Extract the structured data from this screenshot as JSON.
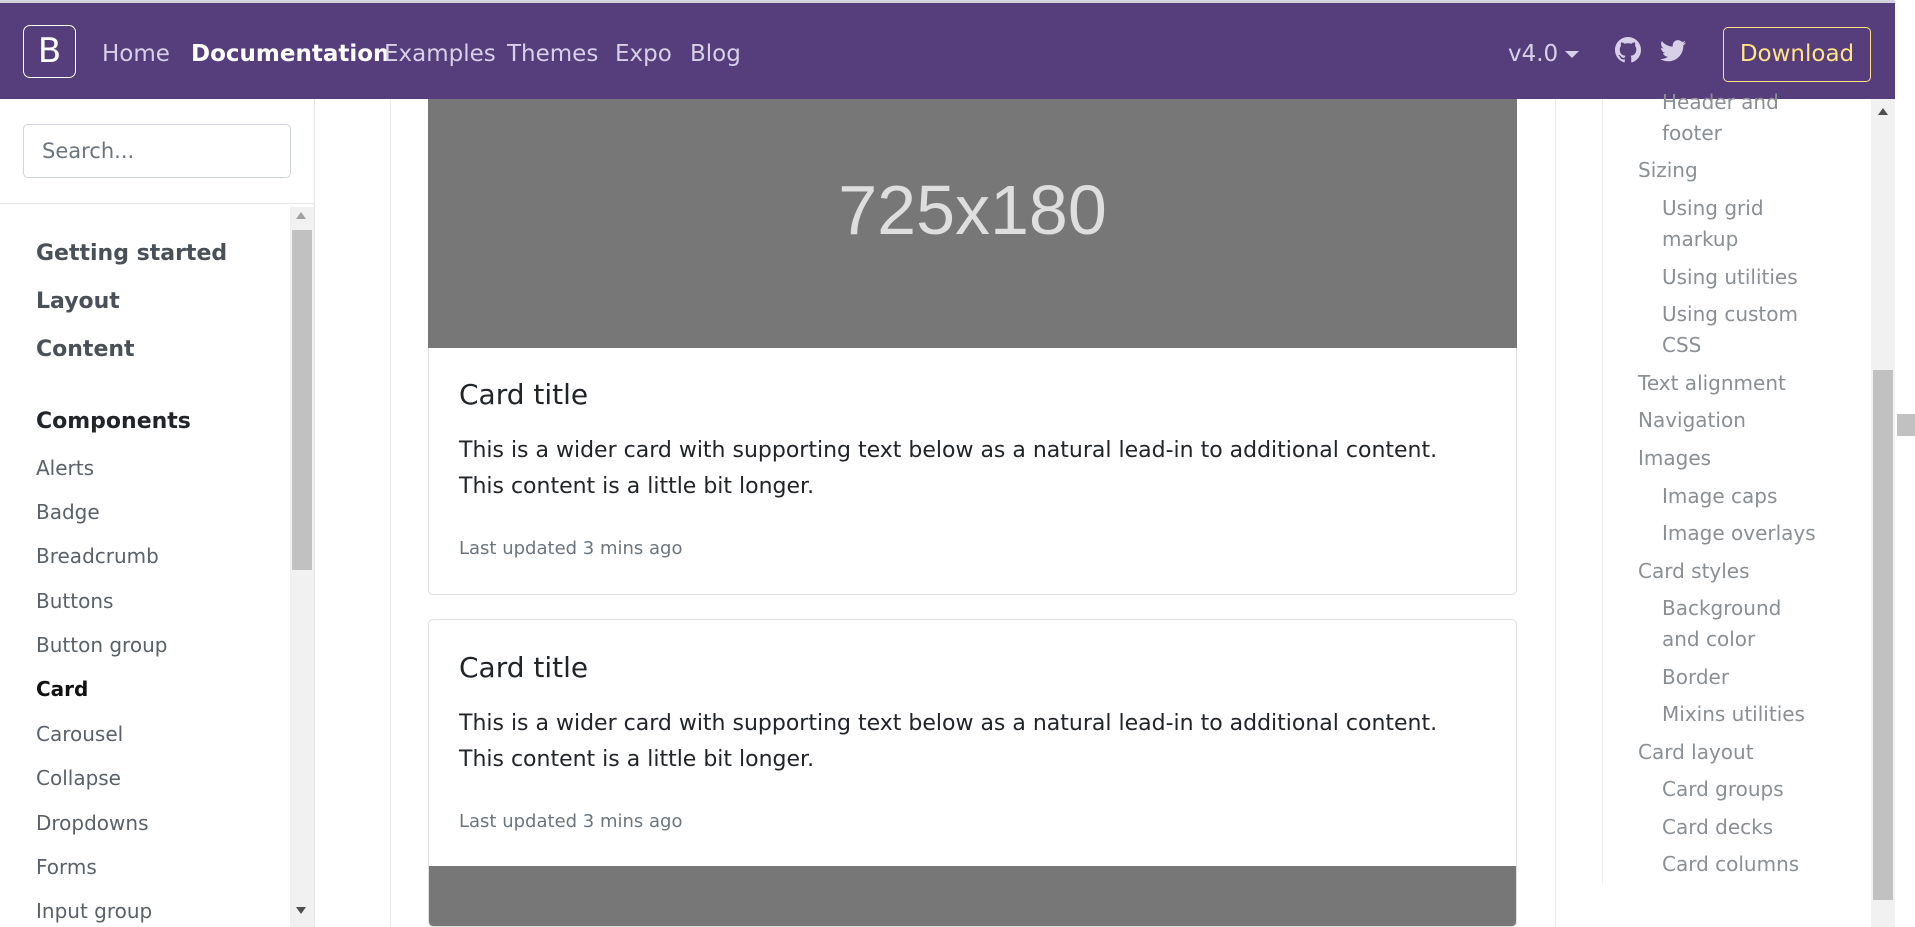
{
  "navbar": {
    "brand": "B",
    "links": [
      "Home",
      "Documentation",
      "Examples",
      "Themes",
      "Expo",
      "Blog"
    ],
    "active": "Documentation",
    "version": "v4.0",
    "download": "Download",
    "bg_color": "#563d7c",
    "download_color": "#ffe484"
  },
  "sidebar": {
    "search_placeholder": "Search...",
    "sections_top": [
      "Getting started",
      "Layout",
      "Content"
    ],
    "components_heading": "Components",
    "items": [
      "Alerts",
      "Badge",
      "Breadcrumb",
      "Buttons",
      "Button group",
      "Card",
      "Carousel",
      "Collapse",
      "Dropdowns",
      "Forms",
      "Input group"
    ],
    "active_item": "Card"
  },
  "content": {
    "image_placeholder": "725x180",
    "cards": [
      {
        "title": "Card title",
        "text": "This is a wider card with supporting text below as a natural lead-in to additional content. This content is a little bit longer.",
        "updated": "Last updated 3 mins ago"
      },
      {
        "title": "Card title",
        "text": "This is a wider card with supporting text below as a natural lead-in to additional content. This content is a little bit longer.",
        "updated": "Last updated 3 mins ago"
      }
    ]
  },
  "toc": {
    "items": [
      {
        "label": "Header and footer",
        "level": 2
      },
      {
        "label": "Sizing",
        "level": 1
      },
      {
        "label": "Using grid markup",
        "level": 2
      },
      {
        "label": "Using utilities",
        "level": 2
      },
      {
        "label": "Using custom CSS",
        "level": 2
      },
      {
        "label": "Text alignment",
        "level": 1
      },
      {
        "label": "Navigation",
        "level": 1
      },
      {
        "label": "Images",
        "level": 1
      },
      {
        "label": "Image caps",
        "level": 2
      },
      {
        "label": "Image overlays",
        "level": 2
      },
      {
        "label": "Card styles",
        "level": 1
      },
      {
        "label": "Background and color",
        "level": 2
      },
      {
        "label": "Border",
        "level": 2
      },
      {
        "label": "Mixins utilities",
        "level": 2
      },
      {
        "label": "Card layout",
        "level": 1
      },
      {
        "label": "Card groups",
        "level": 2
      },
      {
        "label": "Card decks",
        "level": 2
      },
      {
        "label": "Card columns",
        "level": 2
      }
    ]
  }
}
